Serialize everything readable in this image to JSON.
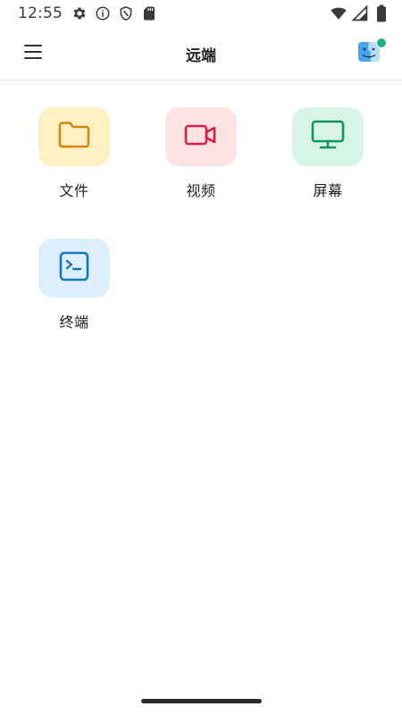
{
  "status_bar": {
    "time": "12:55",
    "left_icons": [
      "settings-icon",
      "info-icon",
      "shield-icon",
      "sd-card-icon"
    ],
    "right_icons": [
      "wifi-icon",
      "cellular-signal-icon",
      "battery-icon"
    ]
  },
  "app_bar": {
    "title": "远端",
    "menu_icon": "hamburger-menu-icon",
    "avatar_icon": "finder-face-icon",
    "online_status_color": "#1db47a"
  },
  "tiles": [
    {
      "label": "文件",
      "icon": "folder-icon",
      "bg": "#fdf1c4",
      "fg": "#d88612"
    },
    {
      "label": "视频",
      "icon": "video-camera-icon",
      "bg": "#fde3e3",
      "fg": "#dc1e47"
    },
    {
      "label": "屏幕",
      "icon": "monitor-icon",
      "bg": "#d6f5e6",
      "fg": "#12935a"
    },
    {
      "label": "终端",
      "icon": "terminal-icon",
      "bg": "#ddeefc",
      "fg": "#1478be"
    }
  ]
}
